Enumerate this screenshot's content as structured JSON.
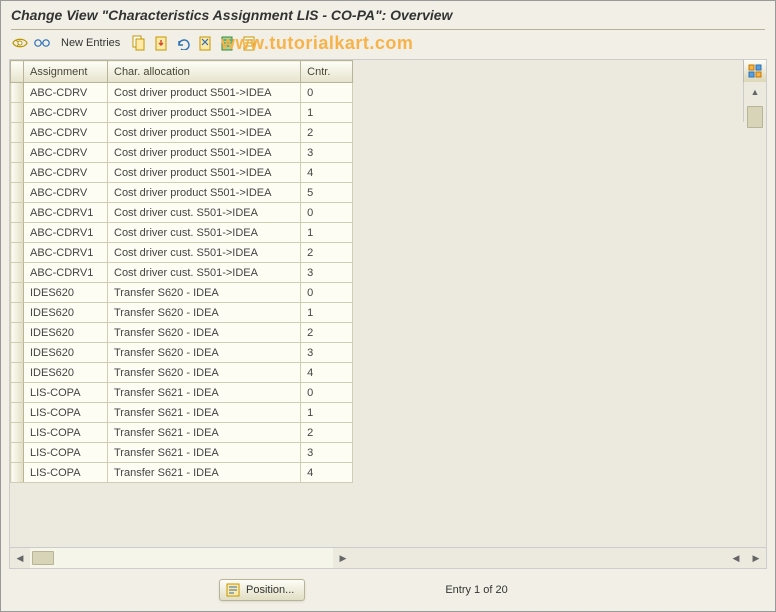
{
  "title": "Change View \"Characteristics Assignment LIS - CO-PA\": Overview",
  "watermark": "www.tutorialkart.com",
  "toolbar": {
    "new_entries": "New Entries",
    "icons": [
      "toggle",
      "glasses",
      "copy",
      "clipboard",
      "arrow",
      "open",
      "save",
      "save-all"
    ]
  },
  "table": {
    "columns": {
      "assignment": "Assignment",
      "allocation": "Char. allocation",
      "cntr": "Cntr."
    },
    "rows": [
      {
        "assignment": "ABC-CDRV",
        "allocation": "Cost driver product S501->IDEA",
        "cntr": "0"
      },
      {
        "assignment": "ABC-CDRV",
        "allocation": "Cost driver product S501->IDEA",
        "cntr": "1"
      },
      {
        "assignment": "ABC-CDRV",
        "allocation": "Cost driver product S501->IDEA",
        "cntr": "2"
      },
      {
        "assignment": "ABC-CDRV",
        "allocation": "Cost driver product S501->IDEA",
        "cntr": "3"
      },
      {
        "assignment": "ABC-CDRV",
        "allocation": "Cost driver product S501->IDEA",
        "cntr": "4"
      },
      {
        "assignment": "ABC-CDRV",
        "allocation": "Cost driver product S501->IDEA",
        "cntr": "5"
      },
      {
        "assignment": "ABC-CDRV1",
        "allocation": "Cost driver cust. S501->IDEA",
        "cntr": "0"
      },
      {
        "assignment": "ABC-CDRV1",
        "allocation": "Cost driver cust. S501->IDEA",
        "cntr": "1"
      },
      {
        "assignment": "ABC-CDRV1",
        "allocation": "Cost driver cust. S501->IDEA",
        "cntr": "2"
      },
      {
        "assignment": "ABC-CDRV1",
        "allocation": "Cost driver cust. S501->IDEA",
        "cntr": "3"
      },
      {
        "assignment": "IDES620",
        "allocation": "Transfer S620 - IDEA",
        "cntr": "0"
      },
      {
        "assignment": "IDES620",
        "allocation": "Transfer S620 - IDEA",
        "cntr": "1"
      },
      {
        "assignment": "IDES620",
        "allocation": "Transfer S620 - IDEA",
        "cntr": "2"
      },
      {
        "assignment": "IDES620",
        "allocation": "Transfer S620 - IDEA",
        "cntr": "3"
      },
      {
        "assignment": "IDES620",
        "allocation": "Transfer S620 - IDEA",
        "cntr": "4"
      },
      {
        "assignment": "LIS-COPA",
        "allocation": "Transfer S621 - IDEA",
        "cntr": "0"
      },
      {
        "assignment": "LIS-COPA",
        "allocation": "Transfer S621 - IDEA",
        "cntr": "1"
      },
      {
        "assignment": "LIS-COPA",
        "allocation": "Transfer S621 - IDEA",
        "cntr": "2"
      },
      {
        "assignment": "LIS-COPA",
        "allocation": "Transfer S621 - IDEA",
        "cntr": "3"
      },
      {
        "assignment": "LIS-COPA",
        "allocation": "Transfer S621 - IDEA",
        "cntr": "4"
      }
    ]
  },
  "status": {
    "position_label": "Position...",
    "entry_text": "Entry 1 of 20"
  }
}
